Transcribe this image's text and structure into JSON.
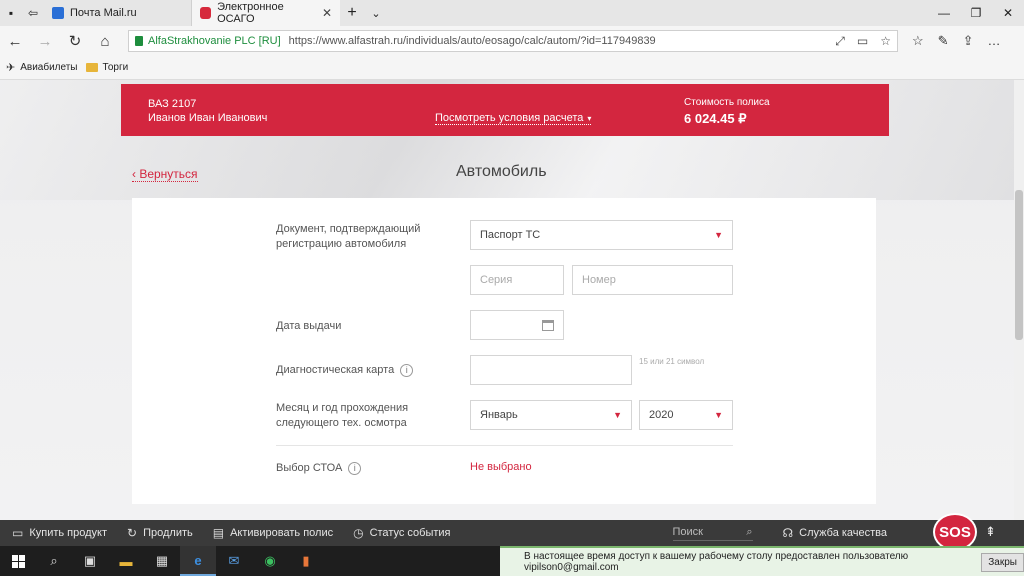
{
  "browser": {
    "tabs": [
      {
        "title": "Почта Mail.ru",
        "active": false
      },
      {
        "title": "Электронное ОСАГО",
        "active": true
      }
    ],
    "site_identity": "AlfaStrakhovanie PLC [RU]",
    "url": "https://www.alfastrah.ru/individuals/auto/eosago/calc/autom/?id=117949839",
    "favorites": [
      "Авиабилеты",
      "Торги"
    ]
  },
  "banner": {
    "car": "ВАЗ 2107",
    "owner": "Иванов Иван Иванович",
    "terms_link": "Посмотреть условия расчета",
    "cost_label": "Стоимость полиса",
    "cost": "6 024.45 ₽"
  },
  "page": {
    "back": "‹ Вернуться",
    "title": "Автомобиль"
  },
  "form": {
    "doc_label": "Документ, подтверждающий регистрацию автомобиля",
    "doc_value": "Паспорт ТС",
    "series_placeholder": "Серия",
    "number_placeholder": "Номер",
    "issue_date_label": "Дата выдачи",
    "diag_label": "Диагностическая карта",
    "diag_hint": "15 или 21 символ",
    "inspection_label": "Месяц и год прохождения следующего тех. осмотра",
    "month_value": "Январь",
    "year_value": "2020",
    "sto_label": "Выбор СТОА",
    "sto_value": "Не выбрано"
  },
  "footer": {
    "buy": "Купить продукт",
    "extend": "Продлить",
    "activate": "Активировать полис",
    "status": "Статус события",
    "search_placeholder": "Поиск",
    "quality": "Служба качества",
    "sos": "SOS"
  },
  "notification": {
    "text": "В настоящее время доступ к вашему рабочему столу предоставлен пользователю vipilson0@gmail.com",
    "close": "Закры"
  },
  "colors": {
    "brand_red": "#d3263f",
    "footer_bg": "#3a3a3a",
    "taskbar_bg": "#1e1e1e"
  }
}
